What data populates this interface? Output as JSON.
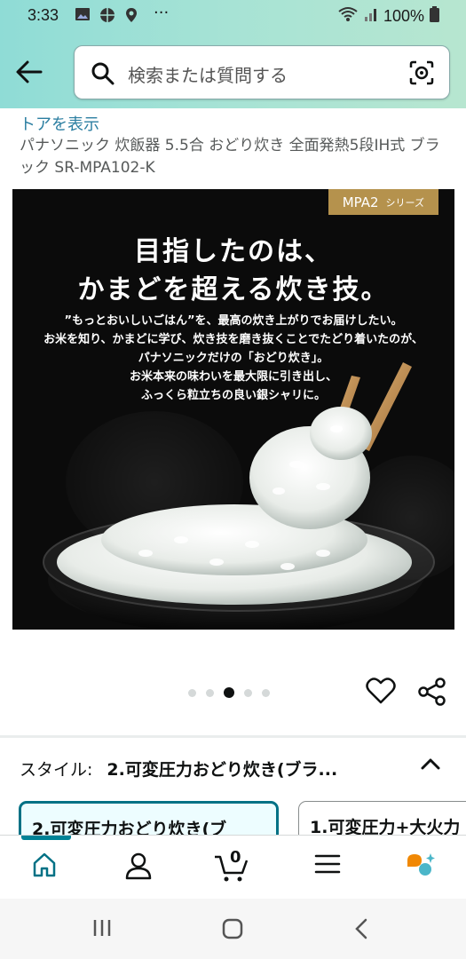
{
  "status_bar": {
    "time": "3:33",
    "battery": "100%"
  },
  "search": {
    "placeholder": "検索または質問する"
  },
  "product": {
    "store_link": "トアを表示",
    "title": "パナソニック 炊飯器 5.5合 おどり炊き 全面発熱5段IH式 ブラック SR-MPA102-K"
  },
  "hero": {
    "badge_main": "MPA2",
    "badge_sub": "シリーズ",
    "headline": [
      "目指したのは、",
      "かまどを超える炊き技。"
    ],
    "body": [
      "”もっとおいしいごはん”を、最高の炊き上がりでお届けしたい。",
      "お米を知り、かまどに学び、炊き技を磨き抜くことでたどり着いたのが、",
      "パナソニックだけの「おどり炊き」。",
      "お米本来の味わいを最大限に引き出し、",
      "ふっくら粒立ちの良い銀シャリに。"
    ]
  },
  "carousel": {
    "total": 5,
    "active_index": 2
  },
  "style_selector": {
    "label": "スタイル:",
    "value": "2.可変圧力おどり炊き(ブラ...",
    "options": [
      "2.可変圧力おどり炊き(ブ",
      "1.可変圧力+大火力"
    ]
  },
  "bottom_nav": {
    "cart_count": "0",
    "items": [
      "home-icon",
      "account-icon",
      "cart-icon",
      "menu-icon",
      "rufus-icon"
    ]
  },
  "colors": {
    "accent": "#007185",
    "header": "#a7e3d5",
    "badge": "#b5924d"
  }
}
